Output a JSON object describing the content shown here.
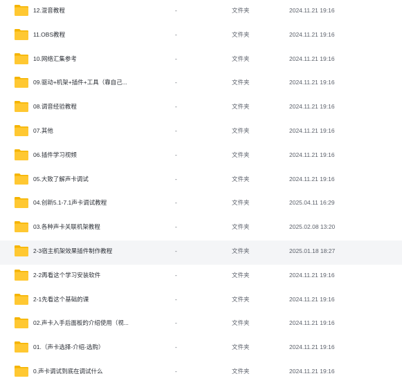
{
  "columns": {
    "size_empty": "-",
    "type_label": "文件夹"
  },
  "colors": {
    "folder_body": "#FFC832",
    "folder_tab": "#F5B400",
    "highlight_row": "#f4f5f7"
  },
  "icon": "folder-icon",
  "highlighted_index": 10,
  "files": [
    {
      "name": "12.混音教程",
      "size": "-",
      "type": "文件夹",
      "modified": "2024.11.21 19:16"
    },
    {
      "name": "11.OBS教程",
      "size": "-",
      "type": "文件夹",
      "modified": "2024.11.21 19:16"
    },
    {
      "name": "10.网络汇集参考",
      "size": "-",
      "type": "文件夹",
      "modified": "2024.11.21 19:16"
    },
    {
      "name": "09.驱动+机架+插件+工具（靠自己...",
      "size": "-",
      "type": "文件夹",
      "modified": "2024.11.21 19:16"
    },
    {
      "name": "08.调音经验教程",
      "size": "-",
      "type": "文件夹",
      "modified": "2024.11.21 19:16"
    },
    {
      "name": "07.其他",
      "size": "-",
      "type": "文件夹",
      "modified": "2024.11.21 19:16"
    },
    {
      "name": "06.插件学习视频",
      "size": "-",
      "type": "文件夹",
      "modified": "2024.11.21 19:16"
    },
    {
      "name": "05.大致了解声卡调试",
      "size": "-",
      "type": "文件夹",
      "modified": "2024.11.21 19:16"
    },
    {
      "name": "04.创新5.1-7.1声卡调试教程",
      "size": "-",
      "type": "文件夹",
      "modified": "2025.04.11 16:29"
    },
    {
      "name": "03.各种声卡关联机架教程",
      "size": "-",
      "type": "文件夹",
      "modified": "2025.02.08 13:20"
    },
    {
      "name": "2-3宿主机架效果插件制作教程",
      "size": "-",
      "type": "文件夹",
      "modified": "2025.01.18 18:27"
    },
    {
      "name": "2-2再看这个学习安装软件",
      "size": "-",
      "type": "文件夹",
      "modified": "2024.11.21 19:16"
    },
    {
      "name": "2-1先看这个基础的课",
      "size": "-",
      "type": "文件夹",
      "modified": "2024.11.21 19:16"
    },
    {
      "name": "02.声卡入手后面板的介绍使用（视...",
      "size": "-",
      "type": "文件夹",
      "modified": "2024.11.21 19:16"
    },
    {
      "name": "01.（声卡选择-介绍-选购）",
      "size": "-",
      "type": "文件夹",
      "modified": "2024.11.21 19:16"
    },
    {
      "name": "0.声卡调试到底在调试什么",
      "size": "-",
      "type": "文件夹",
      "modified": "2024.11.21 19:16"
    }
  ]
}
